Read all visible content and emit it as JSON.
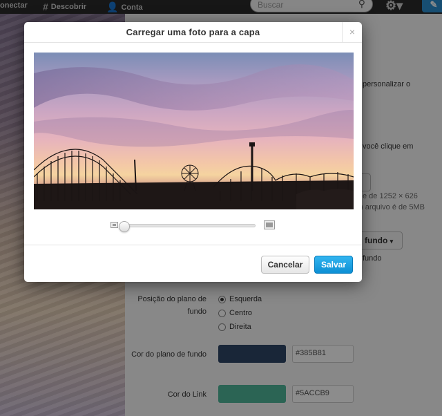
{
  "topbar": {
    "connect": "onectar",
    "discover": "Descobrir",
    "account": "Conta",
    "search_placeholder": "Buscar"
  },
  "settings": {
    "text_customize": "personalizar o",
    "text_click": "você clique em",
    "text_size": "e de 1252 × 626",
    "text_max": ") arquivo é de 5MB",
    "text_theme_btn": "fundo",
    "text_theme_sub": "fundo",
    "bg_position_label": "Posição do plano de fundo",
    "bg_position_options": [
      "Esquerda",
      "Centro",
      "Direita"
    ],
    "bg_position_selected": "Esquerda",
    "bg_color_label": "Cor do plano de fundo",
    "bg_color_value": "#385B81",
    "link_color_label": "Cor do Link",
    "link_color_value": "#5ACCB9"
  },
  "modal": {
    "title": "Carregar uma foto para a capa",
    "close": "×",
    "zoom_level": 0,
    "cancel_label": "Cancelar",
    "save_label": "Salvar"
  },
  "colors": {
    "save_button": "#1a9fe0",
    "bg_swatch": "#2f4566",
    "link_swatch": "#4fb79a",
    "theme_swatches": [
      "#c0306a",
      "#5ab8c8",
      "#e8c83a"
    ]
  }
}
